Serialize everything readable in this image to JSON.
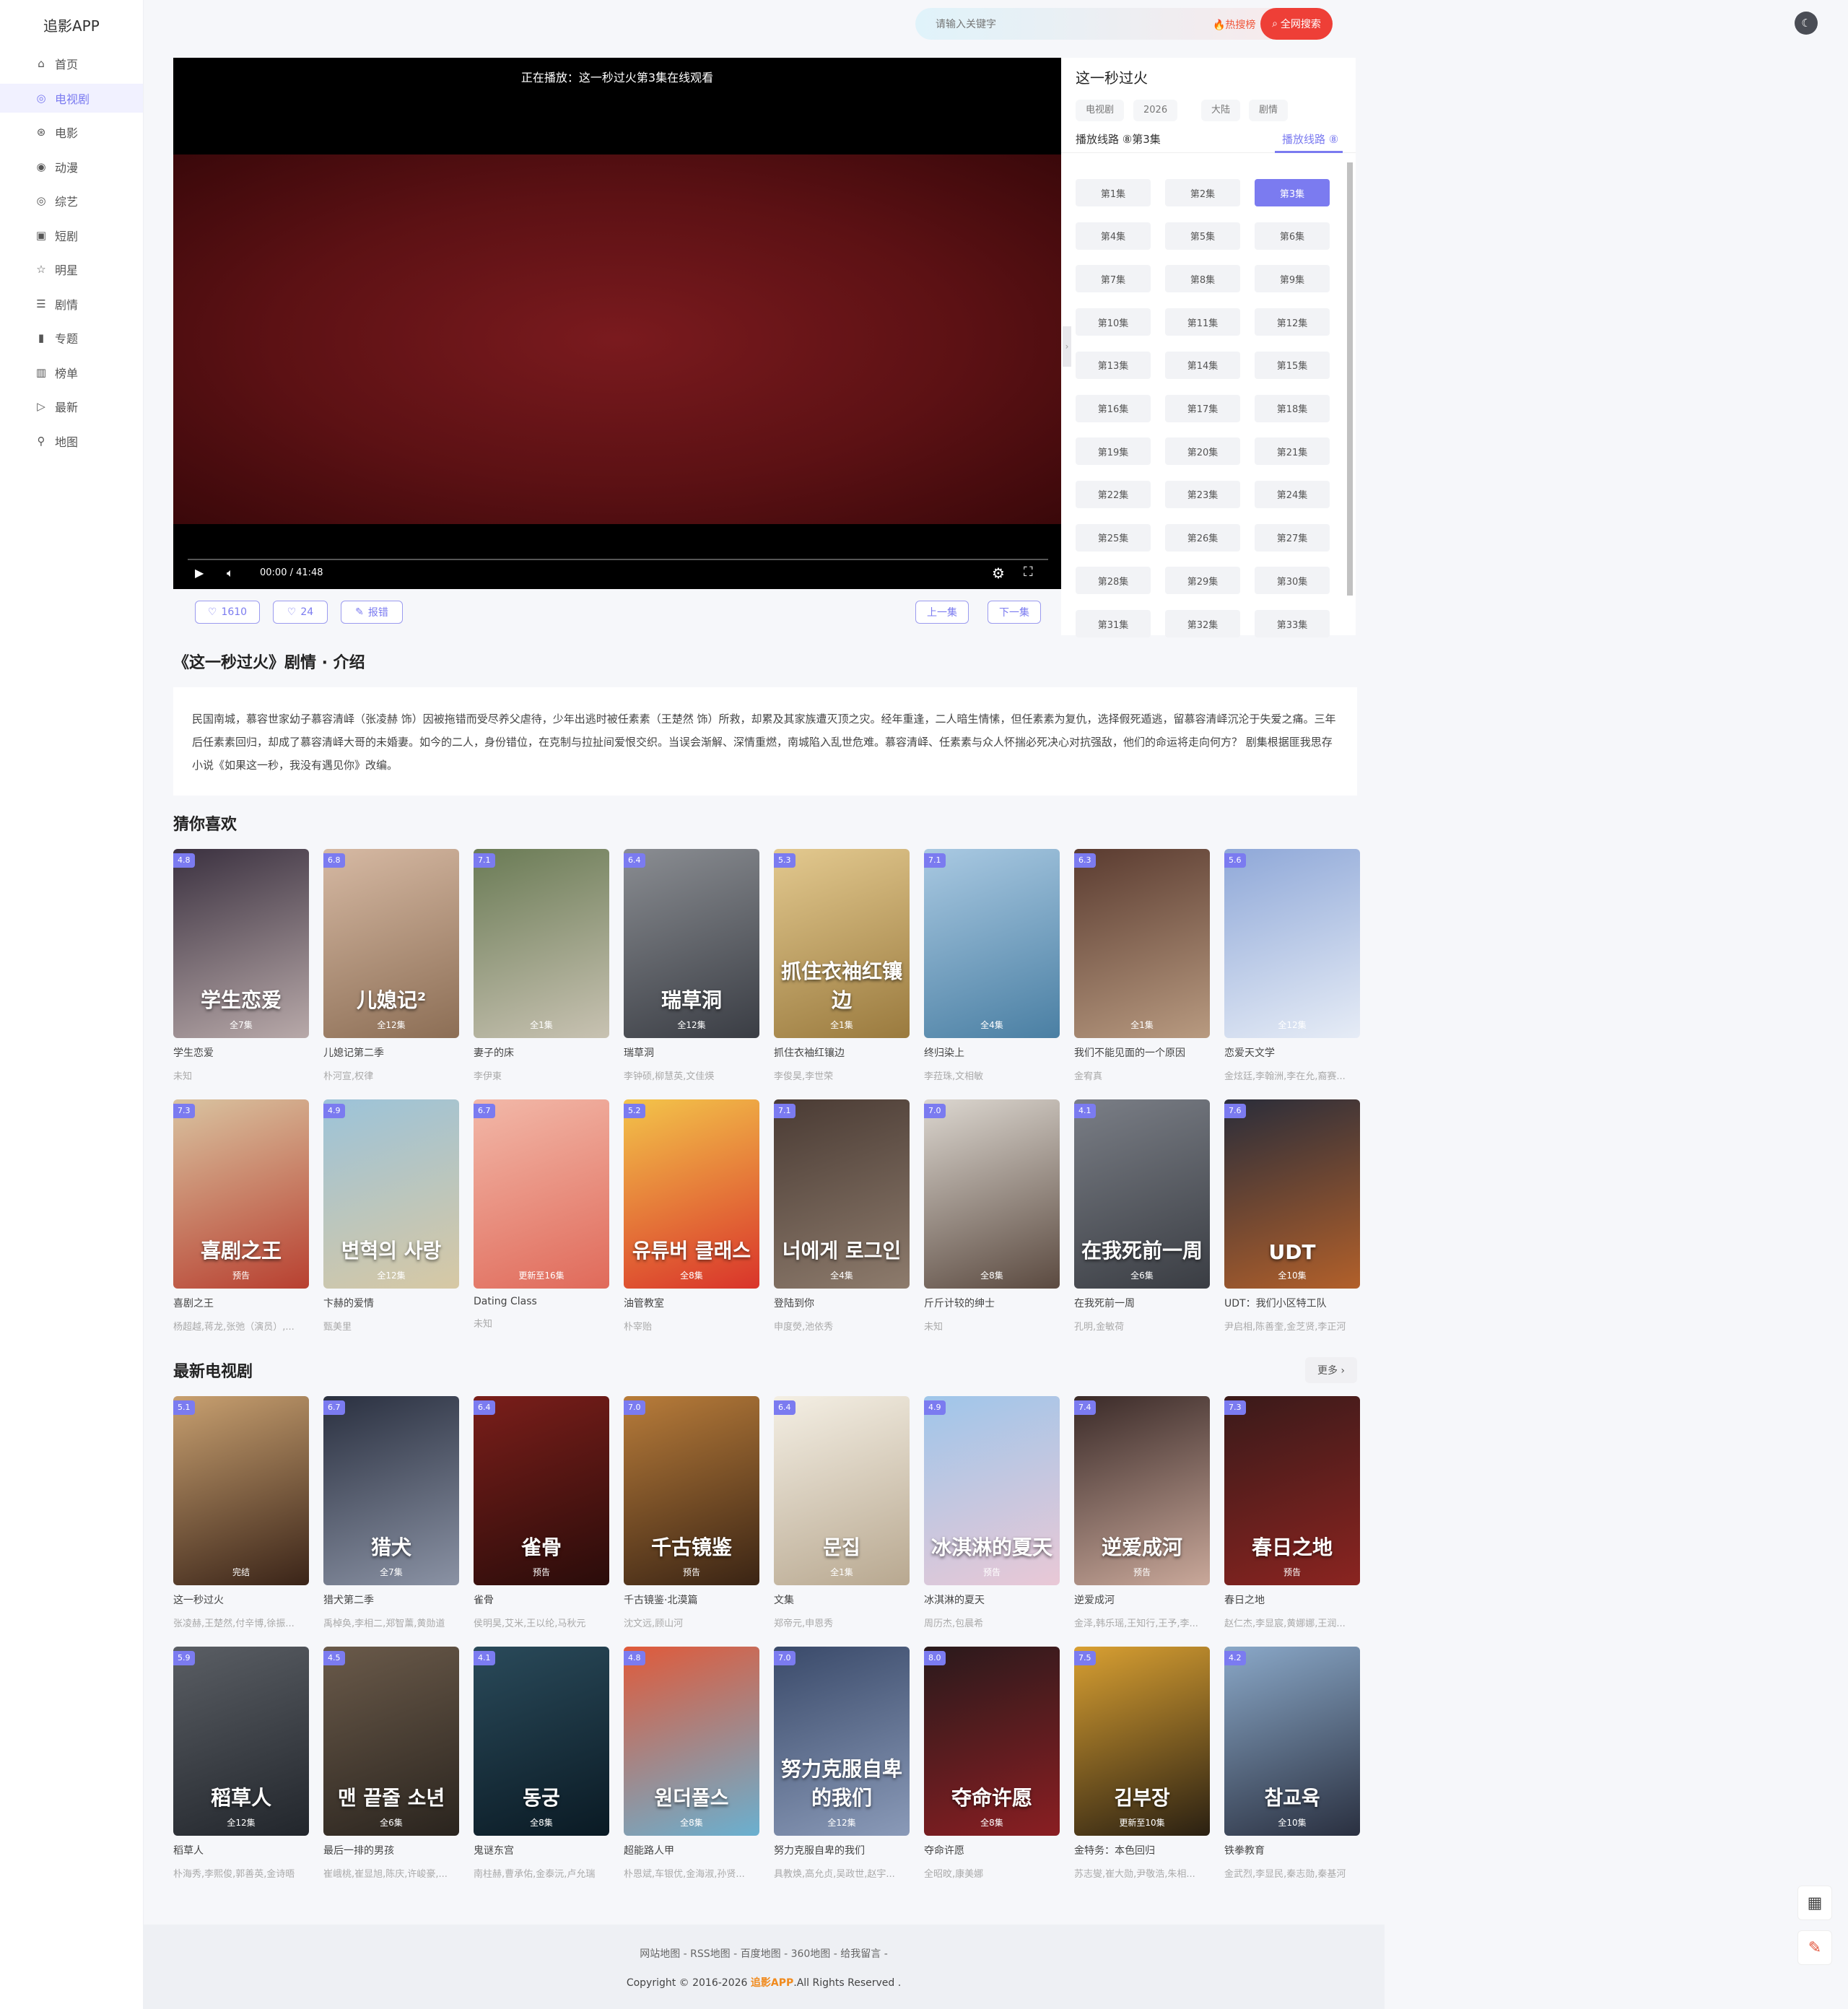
{
  "app": {
    "logo": "追影APP"
  },
  "sidebar": {
    "items": [
      {
        "label": "首页",
        "icon": "home-icon",
        "glyph": "⌂"
      },
      {
        "label": "电视剧",
        "icon": "tv-icon",
        "glyph": "◎"
      },
      {
        "label": "电影",
        "icon": "film-icon",
        "glyph": "⊛"
      },
      {
        "label": "动漫",
        "icon": "anime-icon",
        "glyph": "◉"
      },
      {
        "label": "综艺",
        "icon": "variety-icon",
        "glyph": "◎"
      },
      {
        "label": "短剧",
        "icon": "short-drama-icon",
        "glyph": "▣"
      },
      {
        "label": "明星",
        "icon": "star-icon",
        "glyph": "☆"
      },
      {
        "label": "剧情",
        "icon": "plot-icon",
        "glyph": "☰"
      },
      {
        "label": "专题",
        "icon": "topic-icon",
        "glyph": "▮"
      },
      {
        "label": "榜单",
        "icon": "ranking-icon",
        "glyph": "▥"
      },
      {
        "label": "最新",
        "icon": "latest-icon",
        "glyph": "▷"
      },
      {
        "label": "地图",
        "icon": "map-icon",
        "glyph": "⚲"
      }
    ]
  },
  "search": {
    "placeholder": "请输入关键字",
    "hot": "🔥热搜榜",
    "button": "全网搜索"
  },
  "player": {
    "title": "正在播放：这一秒过火第3集在线观看",
    "time": "00:00 / 41:48"
  },
  "actions": {
    "likes": "1610",
    "dislikes": "24",
    "report": "报错",
    "prev": "上一集",
    "next": "下一集"
  },
  "panel": {
    "title": "这一秒过火",
    "tags": [
      "电视剧",
      "2026",
      "大陆",
      "剧情"
    ],
    "line_label": "播放线路 ⑧第3集",
    "line_tab": "播放线路 ⑧",
    "episodes": [
      "第1集",
      "第2集",
      "第3集",
      "第4集",
      "第5集",
      "第6集",
      "第7集",
      "第8集",
      "第9集",
      "第10集",
      "第11集",
      "第12集",
      "第13集",
      "第14集",
      "第15集",
      "第16集",
      "第17集",
      "第18集",
      "第19集",
      "第20集",
      "第21集",
      "第22集",
      "第23集",
      "第24集",
      "第25集",
      "第26集",
      "第27集",
      "第28集",
      "第29集",
      "第30集",
      "第31集",
      "第32集",
      "第33集"
    ],
    "active_episode": "第3集"
  },
  "intro": {
    "title": "《这一秒过火》剧情 · 介绍",
    "text": "民国南城，慕容世家幼子慕容清峄（张凌赫 饰）因被拖错而受尽养父虐待，少年出逃时被任素素（王楚然 饰）所救，却累及其家族遭灭顶之灾。经年重逢，二人暗生情愫，但任素素为复仇，选择假死遁逃，留慕容清峄沉沦于失爱之痛。三年后任素素回归，却成了慕容清峄大哥的未婚妻。如今的二人，身份错位，在克制与拉扯间爱恨交织。当误会渐解、深情重燃，南城陷入乱世危难。慕容清峄、任素素与众人怀揣必死决心对抗强敌，他们的命运将走向何方？ 剧集根据匪我思存小说《如果这一秒，我没有遇见你》改编。"
  },
  "recommend": {
    "title": "猜你喜欢",
    "items": [
      {
        "title": "学生恋爱",
        "actors": "未知",
        "score": "4.8",
        "remark": "全7集",
        "ptitle": "学生恋爱",
        "bg": "#3b3140,#b8a9a9"
      },
      {
        "title": "儿媳记第二季",
        "actors": "朴河宣,权律",
        "score": "6.8",
        "remark": "全12集",
        "ptitle": "儿媳记²",
        "bg": "#d6b9a3,#8c6e55"
      },
      {
        "title": "妻子的床",
        "actors": "李伊東",
        "score": "7.1",
        "remark": "全1集",
        "ptitle": "",
        "bg": "#6a7b55,#c8c2b2"
      },
      {
        "title": "瑞草洞",
        "actors": "李钟硕,柳慧英,文佳煐",
        "score": "6.4",
        "remark": "全12集",
        "ptitle": "瑞草洞",
        "bg": "#8a8d92,#3a3d44"
      },
      {
        "title": "抓住衣袖红镶边",
        "actors": "李俊昊,李世荣",
        "score": "5.3",
        "remark": "全1集",
        "ptitle": "抓住衣袖红镶边",
        "bg": "#e3c98f,#9a7a3e"
      },
      {
        "title": "终归染上",
        "actors": "李菈珠,文相敏",
        "score": "7.1",
        "remark": "全4集",
        "ptitle": "",
        "bg": "#a9c9e2,#4a7fa3"
      },
      {
        "title": "我们不能见面的一个原因",
        "actors": "金宥真",
        "score": "6.3",
        "remark": "全1集",
        "ptitle": "",
        "bg": "#5a3b30,#b89a80"
      },
      {
        "title": "恋爱天文学",
        "actors": "金炫廷,李翰洲,李在允,裔赛...",
        "score": "5.6",
        "remark": "全12集",
        "ptitle": "",
        "bg": "#8fa8d8,#e6ecf6"
      },
      {
        "title": "喜剧之王",
        "actors": "杨超越,蒋龙,张弛（演员）,...",
        "score": "7.3",
        "remark": "预告",
        "ptitle": "喜剧之王",
        "bg": "#d9c3a0,#b84030"
      },
      {
        "title": "卞赫的爱情",
        "actors": "甄美里",
        "score": "4.9",
        "remark": "全12集",
        "ptitle": "변혁의 사랑",
        "bg": "#9cc3d9,#d7c8a4"
      },
      {
        "title": "Dating Class",
        "actors": "未知",
        "score": "6.7",
        "remark": "更新至16集",
        "ptitle": "",
        "bg": "#f2b8a8,#e06a5a"
      },
      {
        "title": "油管教室",
        "actors": "朴宰贻",
        "score": "5.2",
        "remark": "全8集",
        "ptitle": "유튜버 클래스",
        "bg": "#f3c44a,#d9342a"
      },
      {
        "title": "登陆到你",
        "actors": "申度熒,池依秀",
        "score": "7.1",
        "remark": "全4集",
        "ptitle": "너에게 로그인",
        "bg": "#4a3b34,#8d7b6c"
      },
      {
        "title": "斤斤计较的绅士",
        "actors": "未知",
        "score": "7.0",
        "remark": "全8集",
        "ptitle": "",
        "bg": "#dcd7d0,#5b4a40"
      },
      {
        "title": "在我死前一周",
        "actors": "孔明,金敏荷",
        "score": "4.1",
        "remark": "全6集",
        "ptitle": "在我死前一周",
        "bg": "#7a7e86,#3a3d43"
      },
      {
        "title": "UDT：我们小区特工队",
        "actors": "尹启相,陈善奎,金芝贤,李正河",
        "score": "7.6",
        "remark": "全10集",
        "ptitle": "UDT",
        "bg": "#2a2d3a,#b2602a"
      }
    ]
  },
  "latest": {
    "title": "最新电视剧",
    "more": "更多 ›",
    "items": [
      {
        "title": "这一秒过火",
        "actors": "张凌赫,王楚然,付辛博,徐振...",
        "score": "5.1",
        "remark": "完结",
        "ptitle": "",
        "bg": "#c8a070,#3a2418"
      },
      {
        "title": "猎犬第二季",
        "actors": "禹棹奂,李相二,郑智薰,黄勋道",
        "score": "6.7",
        "remark": "全7集",
        "ptitle": "猎犬",
        "bg": "#2a3040,#8a92a4"
      },
      {
        "title": "雀骨",
        "actors": "侯明昊,艾米,王以纶,马秋元",
        "score": "6.4",
        "remark": "预告",
        "ptitle": "雀骨",
        "bg": "#7a1e1a,#2a0c0a"
      },
      {
        "title": "千古镜鉴·北漠篇",
        "actors": "沈文远,顾山河",
        "score": "7.0",
        "remark": "预告",
        "ptitle": "千古镜鉴",
        "bg": "#b87c3a,#3a2414"
      },
      {
        "title": "文集",
        "actors": "郑帝元,申恩秀",
        "score": "6.4",
        "remark": "全1集",
        "ptitle": "문집",
        "bg": "#f4efe4,#b8a890"
      },
      {
        "title": "冰淇淋的夏天",
        "actors": "周历杰,包晨希",
        "score": "4.9",
        "remark": "预告",
        "ptitle": "冰淇淋的夏天",
        "bg": "#9fc6ea,#e9c8d6"
      },
      {
        "title": "逆爱成河",
        "actors": "金泽,韩乐瑶,王知行,王予,李...",
        "score": "7.4",
        "remark": "预告",
        "ptitle": "逆爱成河",
        "bg": "#3a2a28,#c9a89a"
      },
      {
        "title": "春日之地",
        "actors": "赵仁杰,李显宸,黄娜娜,王润...",
        "score": "7.3",
        "remark": "预告",
        "ptitle": "春日之地",
        "bg": "#3a1a1a,#8a2420"
      },
      {
        "title": "稻草人",
        "actors": "朴海秀,李熙俊,郭善英,金诗晤",
        "score": "5.9",
        "remark": "全12集",
        "ptitle": "稻草人",
        "bg": "#5a5e64,#22262c"
      },
      {
        "title": "最后一排的男孩",
        "actors": "崔峨桃,崔显旭,陈庆,许峻豪,...",
        "score": "4.5",
        "remark": "全6集",
        "ptitle": "맨 끝줄 소년",
        "bg": "#6a5a4a,#2a241e"
      },
      {
        "title": "鬼谜东宫",
        "actors": "南柱赫,曹承佑,金泰沅,卢允瑞",
        "score": "4.1",
        "remark": "全8集",
        "ptitle": "동궁",
        "bg": "#2a4a5a,#0a1a24"
      },
      {
        "title": "超能路人甲",
        "actors": "朴恩斌,车银优,金海淑,孙贤...",
        "score": "4.8",
        "remark": "全8集",
        "ptitle": "원더풀스",
        "bg": "#e05a3a,#6ab0d0"
      },
      {
        "title": "努力克服自卑的我们",
        "actors": "具教焕,高允贞,吴政世,赵宇...",
        "score": "7.0",
        "remark": "全12集",
        "ptitle": "努力克服自卑的我们",
        "bg": "#3a4a6a,#8a9ab8"
      },
      {
        "title": "夺命许愿",
        "actors": "全昭旼,康美娜",
        "score": "8.0",
        "remark": "全8集",
        "ptitle": "夺命许愿",
        "bg": "#2a1a1c,#8a1e22"
      },
      {
        "title": "金特务：本色回归",
        "actors": "苏志燮,崔大勋,尹敬浩,朱相...",
        "score": "7.5",
        "remark": "更新至10集",
        "ptitle": "김부장",
        "bg": "#d9a032,#2a2012"
      },
      {
        "title": "铁拳教育",
        "actors": "金武烈,李显民,秦志勋,秦基河",
        "score": "4.2",
        "remark": "全10集",
        "ptitle": "참교육",
        "bg": "#8aa8c8,#2a3040"
      }
    ]
  },
  "footer": {
    "links": [
      "网站地图",
      "RSS地图",
      "百度地图",
      "360地图",
      "给我留言"
    ],
    "copy_pre": "Copyright © 2016-2026",
    "brand": "追影APP",
    "copy_post": ".All Rights Reserved ."
  }
}
